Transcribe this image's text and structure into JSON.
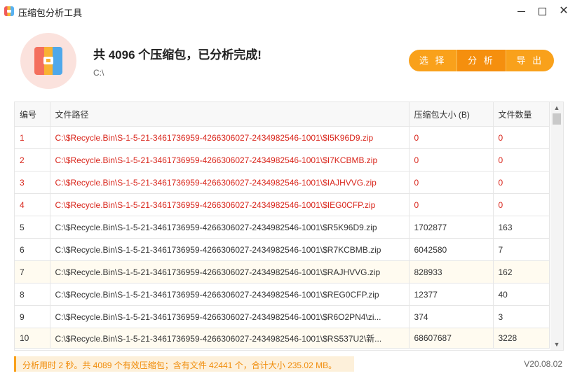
{
  "window": {
    "title": "压缩包分析工具",
    "app_icon": "archive-icon"
  },
  "header": {
    "headline": "共 4096 个压缩包，已分析完成!",
    "path": "C:\\",
    "buttons": {
      "select": "选 择",
      "analyze": "分 析",
      "export": "导 出"
    },
    "accent_color": "#f9a11b"
  },
  "table": {
    "columns": [
      "编号",
      "文件路径",
      "压缩包大小 (B)",
      "文件数量"
    ],
    "rows": [
      {
        "id": "1",
        "path": "C:\\$Recycle.Bin\\S-1-5-21-3461736959-4266306027-2434982546-1001\\$I5K96D9.zip",
        "size": "0",
        "count": "0"
      },
      {
        "id": "2",
        "path": "C:\\$Recycle.Bin\\S-1-5-21-3461736959-4266306027-2434982546-1001\\$I7KCBMB.zip",
        "size": "0",
        "count": "0"
      },
      {
        "id": "3",
        "path": "C:\\$Recycle.Bin\\S-1-5-21-3461736959-4266306027-2434982546-1001\\$IAJHVVG.zip",
        "size": "0",
        "count": "0"
      },
      {
        "id": "4",
        "path": "C:\\$Recycle.Bin\\S-1-5-21-3461736959-4266306027-2434982546-1001\\$IEG0CFP.zip",
        "size": "0",
        "count": "0"
      },
      {
        "id": "5",
        "path": "C:\\$Recycle.Bin\\S-1-5-21-3461736959-4266306027-2434982546-1001\\$R5K96D9.zip",
        "size": "1702877",
        "count": "163"
      },
      {
        "id": "6",
        "path": "C:\\$Recycle.Bin\\S-1-5-21-3461736959-4266306027-2434982546-1001\\$R7KCBMB.zip",
        "size": "6042580",
        "count": "7"
      },
      {
        "id": "7",
        "path": "C:\\$Recycle.Bin\\S-1-5-21-3461736959-4266306027-2434982546-1001\\$RAJHVVG.zip",
        "size": "828933",
        "count": "162"
      },
      {
        "id": "8",
        "path": "C:\\$Recycle.Bin\\S-1-5-21-3461736959-4266306027-2434982546-1001\\$REG0CFP.zip",
        "size": "12377",
        "count": "40"
      },
      {
        "id": "9",
        "path": "C:\\$Recycle.Bin\\S-1-5-21-3461736959-4266306027-2434982546-1001\\$R6O2PN4\\zi...",
        "size": "374",
        "count": "3"
      },
      {
        "id": "10",
        "path": "C:\\$Recycle.Bin\\S-1-5-21-3461736959-4266306027-2434982546-1001\\$RS537U2\\新...",
        "size": "68607687",
        "count": "3228"
      }
    ]
  },
  "status": {
    "summary": "分析用时 2 秒。共 4089 个有效压缩包；含有文件 42441 个，合计大小 235.02 MB。",
    "version": "V20.08.02"
  }
}
